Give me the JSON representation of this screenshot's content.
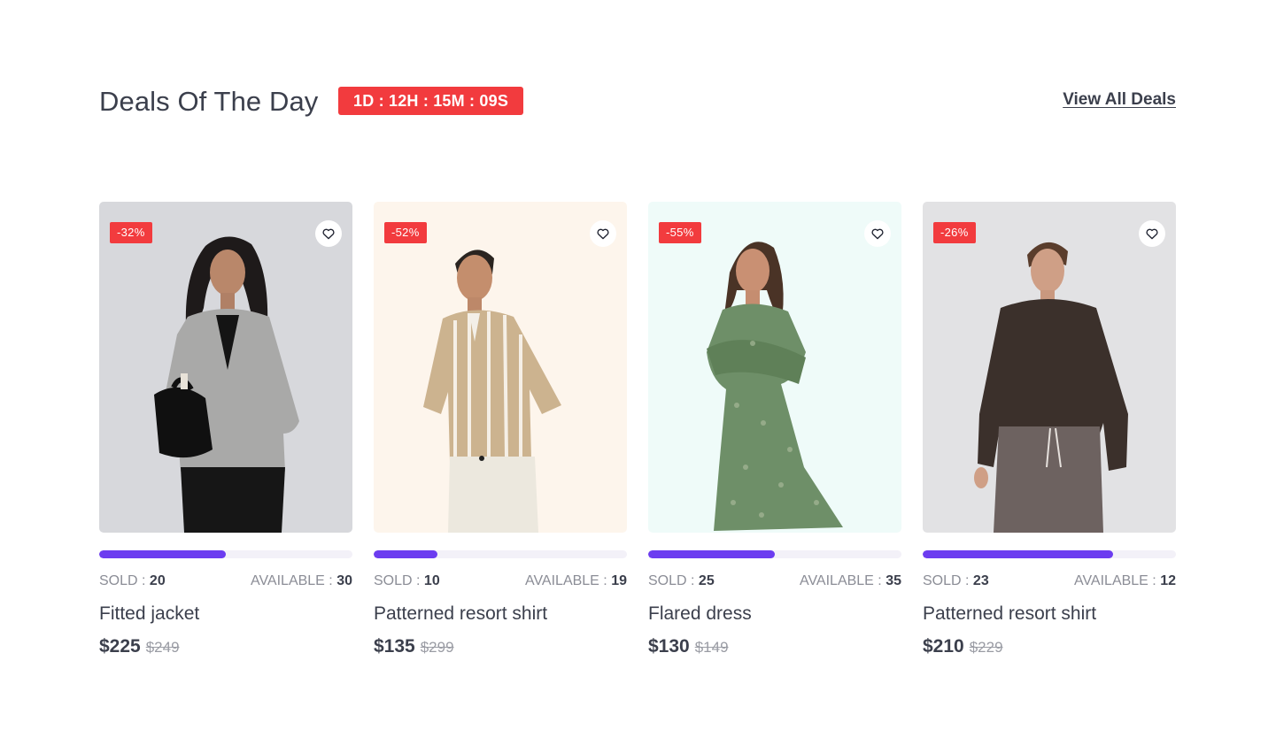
{
  "section": {
    "title": "Deals Of The Day",
    "countdown": "1D : 12H : 15M : 09S",
    "view_all": "View All Deals"
  },
  "labels": {
    "sold": "SOLD",
    "available": "AVAILABLE"
  },
  "colors": {
    "accent": "#6c3cf0",
    "badge": "#f23b3e",
    "text": "#3b3f4c",
    "muted": "#8b8d96"
  },
  "products": [
    {
      "discount": "-32%",
      "sold": "20",
      "available": "30",
      "sold_fraction": 0.5,
      "name": "Fitted jacket",
      "price": "$225",
      "old_price": "$249",
      "bg": "#d7d8dc",
      "image": "woman in grey blazer with black bag"
    },
    {
      "discount": "-52%",
      "sold": "10",
      "available": "19",
      "sold_fraction": 0.25,
      "name": "Patterned resort shirt",
      "price": "$135",
      "old_price": "$299",
      "bg": "#fdf5ec",
      "image": "man in striped resort shirt"
    },
    {
      "discount": "-55%",
      "sold": "25",
      "available": "35",
      "sold_fraction": 0.5,
      "name": "Flared dress",
      "price": "$130",
      "old_price": "$149",
      "bg": "#effbf9",
      "image": "woman in green paisley dress"
    },
    {
      "discount": "-26%",
      "sold": "23",
      "available": "12",
      "sold_fraction": 0.75,
      "name": "Patterned resort shirt",
      "price": "$210",
      "old_price": "$229",
      "bg": "#e2e2e4",
      "image": "man in dark sweatshirt and grey joggers"
    }
  ]
}
